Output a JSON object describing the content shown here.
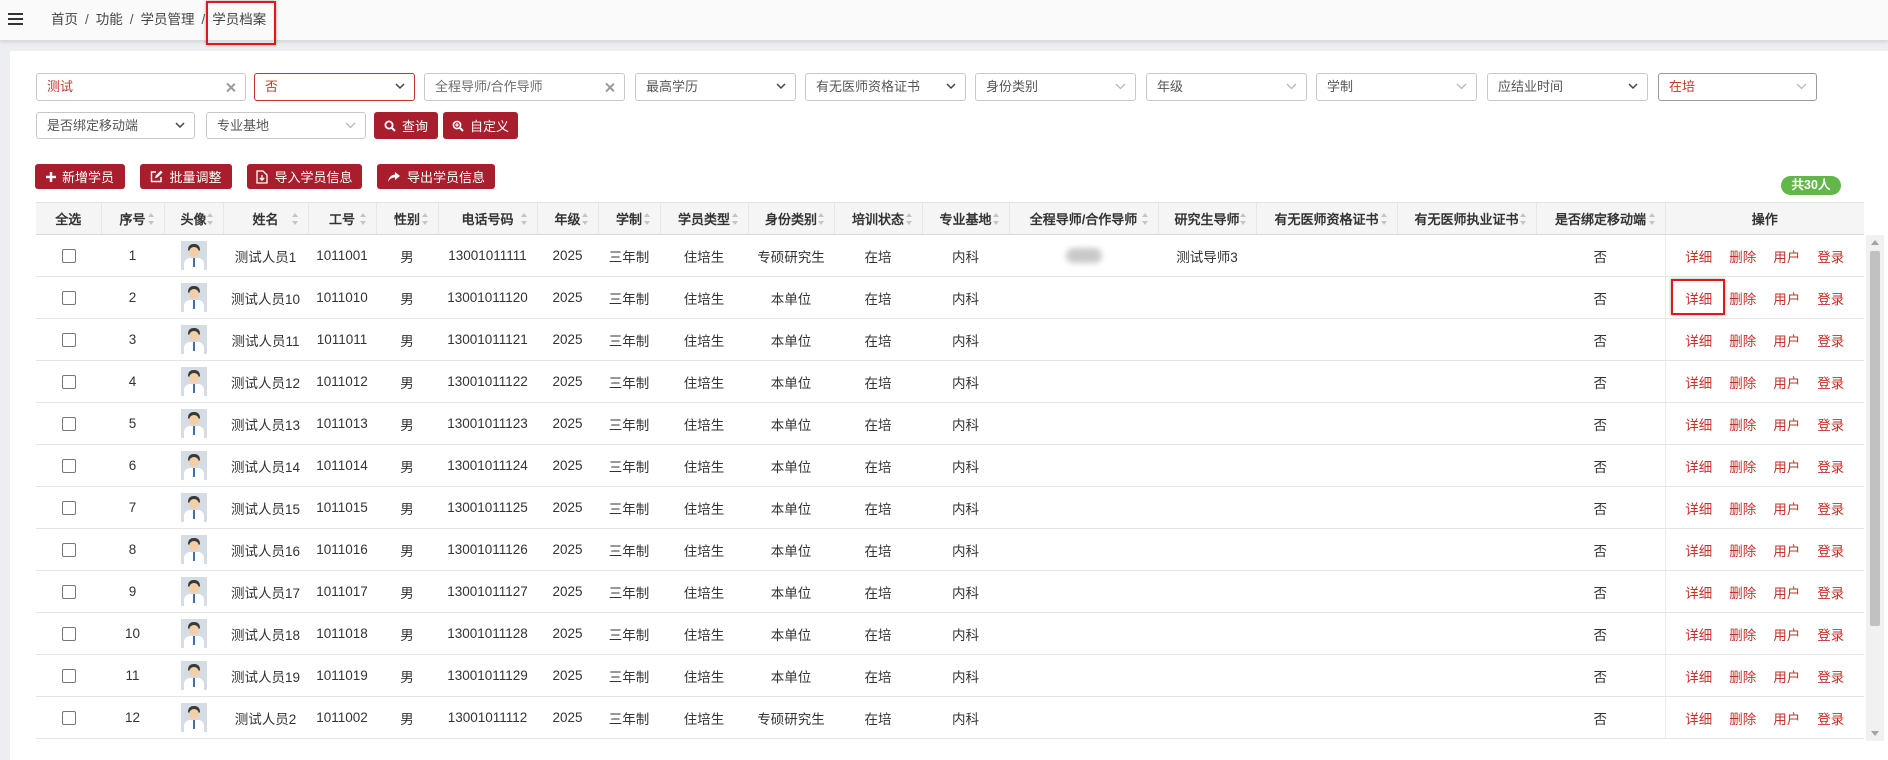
{
  "colors": {
    "primary": "#a81e2d",
    "link": "#c7302b",
    "highlight_text": "#c0392b",
    "badge": "#62b74a",
    "annotation": "#e0181b"
  },
  "topbar": {
    "menu_icon": "hamburger-menu-icon",
    "separator": "/",
    "breadcrumb": [
      {
        "label": "首页"
      },
      {
        "label": "功能"
      },
      {
        "label": "学员管理"
      },
      {
        "label": "学员档案"
      }
    ]
  },
  "filters": {
    "name": {
      "value": "测试"
    },
    "yes_no": {
      "value": "否"
    },
    "mentor": {
      "placeholder": "全程导师/合作导师"
    },
    "education": {
      "placeholder": "最高学历"
    },
    "qualification_cert": {
      "placeholder": "有无医师资格证书"
    },
    "identity": {
      "placeholder": "身份类别"
    },
    "grade": {
      "placeholder": "年级"
    },
    "program_length": {
      "placeholder": "学制"
    },
    "graduation_time": {
      "placeholder": "应结业时间"
    },
    "training_status": {
      "value": "在培"
    },
    "mobile_bound": {
      "placeholder": "是否绑定移动端"
    },
    "specialty_base": {
      "placeholder": "专业基地"
    },
    "search_label": "查询",
    "custom_label": "自定义"
  },
  "toolbar": {
    "add_label": "新增学员",
    "batch_label": "批量调整",
    "import_label": "导入学员信息",
    "export_label": "导出学员信息"
  },
  "total_badge": "共30人",
  "table": {
    "columns": [
      {
        "key": "select_all",
        "label": "全选",
        "sortable": false
      },
      {
        "key": "no",
        "label": "序号",
        "sortable": true
      },
      {
        "key": "avatar",
        "label": "头像",
        "sortable": true
      },
      {
        "key": "name",
        "label": "姓名",
        "sortable": true
      },
      {
        "key": "emp_id",
        "label": "工号",
        "sortable": true
      },
      {
        "key": "gender",
        "label": "性别",
        "sortable": true
      },
      {
        "key": "phone",
        "label": "电话号码",
        "sortable": true
      },
      {
        "key": "grade",
        "label": "年级",
        "sortable": true
      },
      {
        "key": "length",
        "label": "学制",
        "sortable": true
      },
      {
        "key": "type",
        "label": "学员类型",
        "sortable": true
      },
      {
        "key": "identity",
        "label": "身份类别",
        "sortable": true
      },
      {
        "key": "status",
        "label": "培训状态",
        "sortable": true
      },
      {
        "key": "base",
        "label": "专业基地",
        "sortable": true
      },
      {
        "key": "mentor",
        "label": "全程导师/合作导师",
        "sortable": true
      },
      {
        "key": "grad_mentor",
        "label": "研究生导师",
        "sortable": true
      },
      {
        "key": "qual_cert",
        "label": "有无医师资格证书",
        "sortable": true
      },
      {
        "key": "prac_cert",
        "label": "有无医师执业证书",
        "sortable": true
      },
      {
        "key": "mobile_bound",
        "label": "是否绑定移动端",
        "sortable": true
      },
      {
        "key": "actions",
        "label": "操作",
        "sortable": false
      }
    ],
    "row_actions": [
      {
        "key": "detail",
        "label": "详细"
      },
      {
        "key": "delete",
        "label": "删除"
      },
      {
        "key": "user",
        "label": "用户"
      },
      {
        "key": "login",
        "label": "登录"
      }
    ],
    "rows": [
      {
        "no": "1",
        "name": "测试人员1",
        "emp_id": "1011001",
        "gender": "男",
        "phone": "13001011111",
        "grade": "2025",
        "length": "三年制",
        "type": "住培生",
        "identity": "专硕研究生",
        "status": "在培",
        "base": "内科",
        "mentor": "",
        "mentor_redacted": true,
        "grad_mentor": "测试导师3",
        "qual_cert": "",
        "prac_cert": "",
        "mobile_bound": "否"
      },
      {
        "no": "2",
        "name": "测试人员10",
        "emp_id": "1011010",
        "gender": "男",
        "phone": "13001011120",
        "grade": "2025",
        "length": "三年制",
        "type": "住培生",
        "identity": "本单位",
        "status": "在培",
        "base": "内科",
        "mentor": "",
        "grad_mentor": "",
        "qual_cert": "",
        "prac_cert": "",
        "mobile_bound": "否"
      },
      {
        "no": "3",
        "name": "测试人员11",
        "emp_id": "1011011",
        "gender": "男",
        "phone": "13001011121",
        "grade": "2025",
        "length": "三年制",
        "type": "住培生",
        "identity": "本单位",
        "status": "在培",
        "base": "内科",
        "mentor": "",
        "grad_mentor": "",
        "qual_cert": "",
        "prac_cert": "",
        "mobile_bound": "否"
      },
      {
        "no": "4",
        "name": "测试人员12",
        "emp_id": "1011012",
        "gender": "男",
        "phone": "13001011122",
        "grade": "2025",
        "length": "三年制",
        "type": "住培生",
        "identity": "本单位",
        "status": "在培",
        "base": "内科",
        "mentor": "",
        "grad_mentor": "",
        "qual_cert": "",
        "prac_cert": "",
        "mobile_bound": "否"
      },
      {
        "no": "5",
        "name": "测试人员13",
        "emp_id": "1011013",
        "gender": "男",
        "phone": "13001011123",
        "grade": "2025",
        "length": "三年制",
        "type": "住培生",
        "identity": "本单位",
        "status": "在培",
        "base": "内科",
        "mentor": "",
        "grad_mentor": "",
        "qual_cert": "",
        "prac_cert": "",
        "mobile_bound": "否"
      },
      {
        "no": "6",
        "name": "测试人员14",
        "emp_id": "1011014",
        "gender": "男",
        "phone": "13001011124",
        "grade": "2025",
        "length": "三年制",
        "type": "住培生",
        "identity": "本单位",
        "status": "在培",
        "base": "内科",
        "mentor": "",
        "grad_mentor": "",
        "qual_cert": "",
        "prac_cert": "",
        "mobile_bound": "否"
      },
      {
        "no": "7",
        "name": "测试人员15",
        "emp_id": "1011015",
        "gender": "男",
        "phone": "13001011125",
        "grade": "2025",
        "length": "三年制",
        "type": "住培生",
        "identity": "本单位",
        "status": "在培",
        "base": "内科",
        "mentor": "",
        "grad_mentor": "",
        "qual_cert": "",
        "prac_cert": "",
        "mobile_bound": "否"
      },
      {
        "no": "8",
        "name": "测试人员16",
        "emp_id": "1011016",
        "gender": "男",
        "phone": "13001011126",
        "grade": "2025",
        "length": "三年制",
        "type": "住培生",
        "identity": "本单位",
        "status": "在培",
        "base": "内科",
        "mentor": "",
        "grad_mentor": "",
        "qual_cert": "",
        "prac_cert": "",
        "mobile_bound": "否"
      },
      {
        "no": "9",
        "name": "测试人员17",
        "emp_id": "1011017",
        "gender": "男",
        "phone": "13001011127",
        "grade": "2025",
        "length": "三年制",
        "type": "住培生",
        "identity": "本单位",
        "status": "在培",
        "base": "内科",
        "mentor": "",
        "grad_mentor": "",
        "qual_cert": "",
        "prac_cert": "",
        "mobile_bound": "否"
      },
      {
        "no": "10",
        "name": "测试人员18",
        "emp_id": "1011018",
        "gender": "男",
        "phone": "13001011128",
        "grade": "2025",
        "length": "三年制",
        "type": "住培生",
        "identity": "本单位",
        "status": "在培",
        "base": "内科",
        "mentor": "",
        "grad_mentor": "",
        "qual_cert": "",
        "prac_cert": "",
        "mobile_bound": "否"
      },
      {
        "no": "11",
        "name": "测试人员19",
        "emp_id": "1011019",
        "gender": "男",
        "phone": "13001011129",
        "grade": "2025",
        "length": "三年制",
        "type": "住培生",
        "identity": "本单位",
        "status": "在培",
        "base": "内科",
        "mentor": "",
        "grad_mentor": "",
        "qual_cert": "",
        "prac_cert": "",
        "mobile_bound": "否"
      },
      {
        "no": "12",
        "name": "测试人员2",
        "emp_id": "1011002",
        "gender": "男",
        "phone": "13001011112",
        "grade": "2025",
        "length": "三年制",
        "type": "住培生",
        "identity": "专硕研究生",
        "status": "在培",
        "base": "内科",
        "mentor": "",
        "grad_mentor": "",
        "qual_cert": "",
        "prac_cert": "",
        "mobile_bound": "否"
      }
    ]
  }
}
